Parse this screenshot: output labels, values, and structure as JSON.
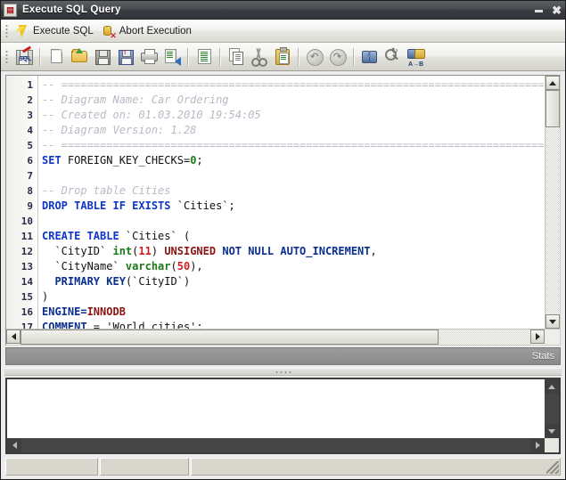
{
  "window": {
    "title": "Execute SQL Query",
    "app_icon": "database-icon",
    "controls": {
      "minimize": "minimize-icon",
      "close": "close-icon"
    }
  },
  "actionbar": {
    "items": [
      {
        "label": "Execute SQL",
        "icon": "lightning-bolt-icon"
      },
      {
        "label": "Abort Execution",
        "icon": "database-abort-icon"
      }
    ]
  },
  "toolbar": {
    "buttons": [
      {
        "name": "sql-icon"
      },
      {
        "name": "new-file-icon"
      },
      {
        "name": "open-folder-icon"
      },
      {
        "name": "save-icon"
      },
      {
        "name": "save-as-icon"
      },
      {
        "name": "print-icon"
      },
      {
        "name": "export-icon"
      },
      {
        "name": "document-icon"
      },
      {
        "name": "copy-icon"
      },
      {
        "name": "cut-icon"
      },
      {
        "name": "paste-icon"
      },
      {
        "name": "undo-icon"
      },
      {
        "name": "redo-icon"
      },
      {
        "name": "find-icon"
      },
      {
        "name": "find-replace-icon"
      },
      {
        "name": "replace-all-icon"
      }
    ]
  },
  "editor": {
    "line_numbers": [
      1,
      2,
      3,
      4,
      5,
      6,
      7,
      8,
      9,
      10,
      11,
      12,
      13,
      14,
      15,
      16,
      17
    ],
    "lines": [
      {
        "n": 1,
        "tokens": [
          {
            "t": "-- =========================================================================================================",
            "c": "cmt"
          }
        ]
      },
      {
        "n": 2,
        "tokens": [
          {
            "t": "-- Diagram Name: Car Ordering",
            "c": "cmt"
          }
        ]
      },
      {
        "n": 3,
        "tokens": [
          {
            "t": "-- Created on: 01.03.2010 19:54:05",
            "c": "cmt"
          }
        ]
      },
      {
        "n": 4,
        "tokens": [
          {
            "t": "-- Diagram Version: 1.28",
            "c": "cmt"
          }
        ]
      },
      {
        "n": 5,
        "tokens": [
          {
            "t": "-- =========================================================================================================",
            "c": "cmt"
          }
        ]
      },
      {
        "n": 6,
        "tokens": [
          {
            "t": "SET",
            "c": "kw"
          },
          {
            "t": " FOREIGN_KEY_CHECKS=",
            "c": "pl"
          },
          {
            "t": "0",
            "c": "typ"
          },
          {
            "t": ";",
            "c": "pl"
          }
        ]
      },
      {
        "n": 7,
        "tokens": [
          {
            "t": "",
            "c": "pl"
          }
        ]
      },
      {
        "n": 8,
        "tokens": [
          {
            "t": "-- Drop table Cities",
            "c": "cmt"
          }
        ]
      },
      {
        "n": 9,
        "tokens": [
          {
            "t": "DROP TABLE IF EXISTS",
            "c": "kw"
          },
          {
            "t": " `Cities`;",
            "c": "pl"
          }
        ]
      },
      {
        "n": 10,
        "tokens": [
          {
            "t": "",
            "c": "pl"
          }
        ]
      },
      {
        "n": 11,
        "tokens": [
          {
            "t": "CREATE TABLE",
            "c": "kw"
          },
          {
            "t": " `Cities` (",
            "c": "pl"
          }
        ]
      },
      {
        "n": 12,
        "tokens": [
          {
            "t": "  `CityID` ",
            "c": "pl"
          },
          {
            "t": "int",
            "c": "typ"
          },
          {
            "t": "(",
            "c": "pl"
          },
          {
            "t": "11",
            "c": "num"
          },
          {
            "t": ") ",
            "c": "pl"
          },
          {
            "t": "UNSIGNED",
            "c": "red"
          },
          {
            "t": " ",
            "c": "pl"
          },
          {
            "t": "NOT NULL AUTO_INCREMENT",
            "c": "kw2"
          },
          {
            "t": ",",
            "c": "pl"
          }
        ]
      },
      {
        "n": 13,
        "tokens": [
          {
            "t": "  `CityName` ",
            "c": "pl"
          },
          {
            "t": "varchar",
            "c": "typ"
          },
          {
            "t": "(",
            "c": "pl"
          },
          {
            "t": "50",
            "c": "num"
          },
          {
            "t": "),",
            "c": "pl"
          }
        ]
      },
      {
        "n": 14,
        "tokens": [
          {
            "t": "  ",
            "c": "pl"
          },
          {
            "t": "PRIMARY KEY",
            "c": "kw2"
          },
          {
            "t": "(`CityID`)",
            "c": "pl"
          }
        ]
      },
      {
        "n": 15,
        "tokens": [
          {
            "t": ")",
            "c": "pl"
          }
        ]
      },
      {
        "n": 16,
        "tokens": [
          {
            "t": "ENGINE=",
            "c": "kw2"
          },
          {
            "t": "INNODB",
            "c": "red"
          }
        ]
      },
      {
        "n": 17,
        "tokens": [
          {
            "t": "COMMENT",
            "c": "kw2"
          },
          {
            "t": " = ",
            "c": "pl"
          },
          {
            "t": "'World cities';",
            "c": "str"
          }
        ]
      }
    ],
    "scroll": {
      "vertical_thumb_pct": 15,
      "horizontal_thumb_pct": 82
    }
  },
  "stats": {
    "label": "Stats"
  },
  "output": {
    "text": ""
  },
  "statusbar": {
    "panels": [
      "",
      "",
      ""
    ]
  },
  "colors": {
    "keyword": "#0f36c8",
    "keyword_dark": "#0b2f8f",
    "type": "#1c7a1c",
    "number": "#cf2020",
    "attribute": "#8b1414",
    "comment": "#b9b9c6",
    "title_bar": "#494c50",
    "stats_bar": "#9b9b9b"
  }
}
